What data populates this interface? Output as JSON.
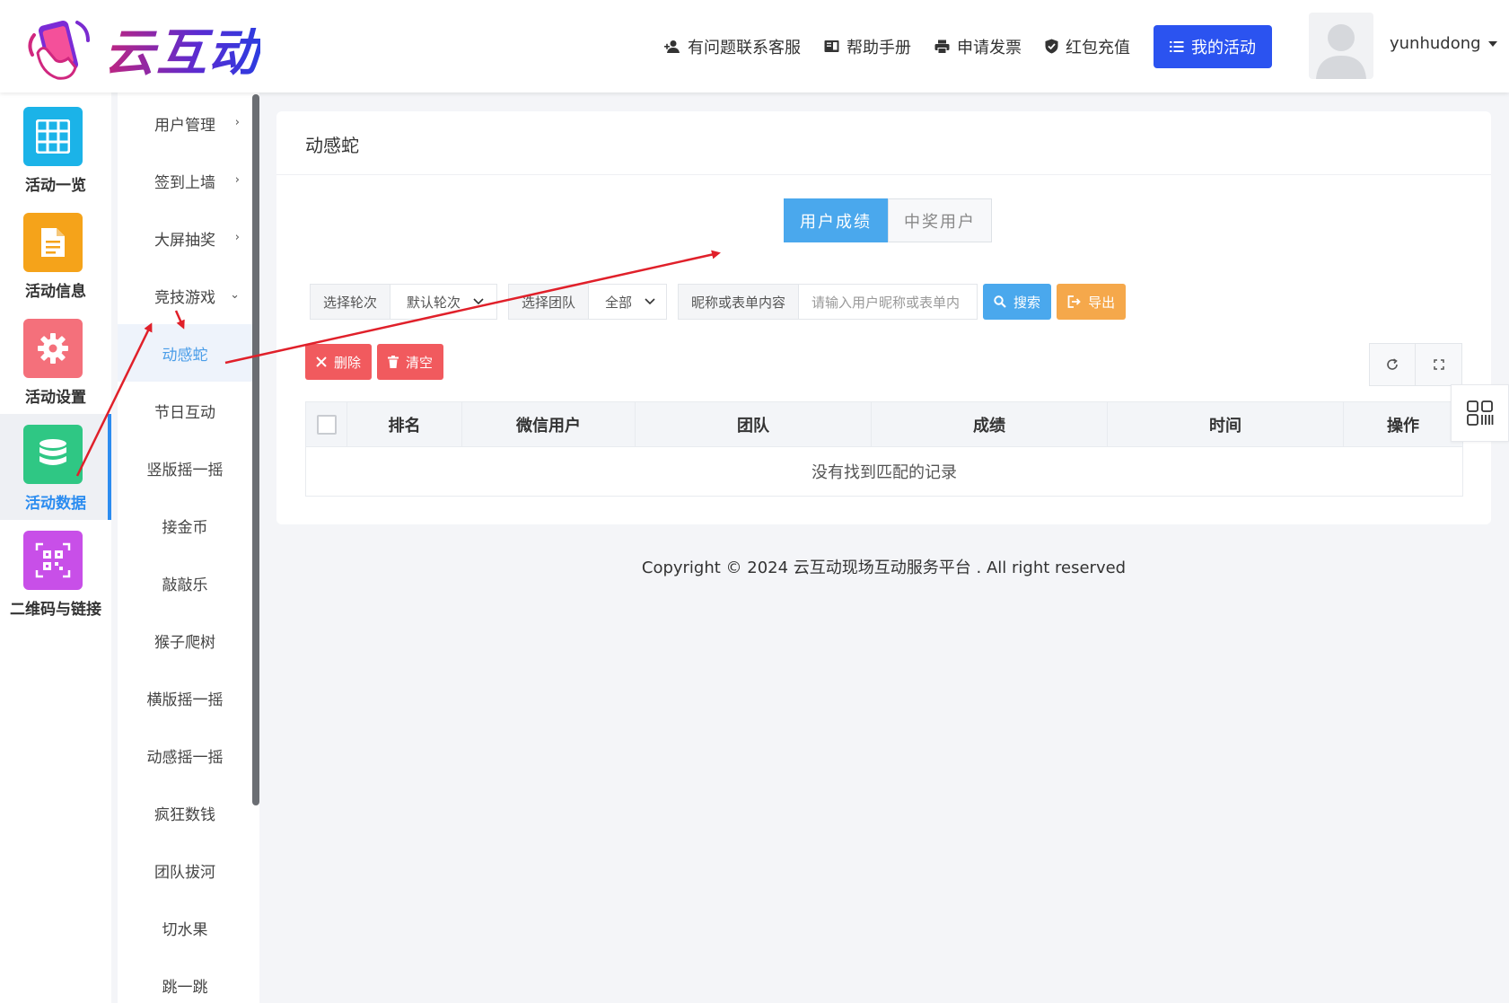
{
  "brand": {
    "name": "云互动"
  },
  "topnav": {
    "support": "有问题联系客服",
    "help": "帮助手册",
    "invoice": "申请发票",
    "recharge": "红包充值",
    "my_activity": "我的活动",
    "username": "yunhudong"
  },
  "iconbar": [
    {
      "label": "活动一览",
      "icon": "grid-icon",
      "color": "#1bb3e8"
    },
    {
      "label": "活动信息",
      "icon": "document-icon",
      "color": "#f5a31a"
    },
    {
      "label": "活动设置",
      "icon": "gear-icon",
      "color": "#f4707b"
    },
    {
      "label": "活动数据",
      "icon": "database-icon",
      "color": "#2fc784",
      "active": true
    },
    {
      "label": "二维码与链接",
      "icon": "qrcode-icon",
      "color": "#c84fe8"
    }
  ],
  "submenu": [
    {
      "label": "用户管理",
      "chevron": "›"
    },
    {
      "label": "签到上墙",
      "chevron": "›"
    },
    {
      "label": "大屏抽奖",
      "chevron": "›"
    },
    {
      "label": "竞技游戏",
      "chevron": "⌄"
    },
    {
      "label": "动感蛇",
      "active": true
    },
    {
      "label": "节日互动"
    },
    {
      "label": "竖版摇一摇"
    },
    {
      "label": "接金币"
    },
    {
      "label": "敲敲乐"
    },
    {
      "label": "猴子爬树"
    },
    {
      "label": "横版摇一摇"
    },
    {
      "label": "动感摇一摇"
    },
    {
      "label": "疯狂数钱"
    },
    {
      "label": "团队拔河"
    },
    {
      "label": "切水果"
    },
    {
      "label": "跳一跳"
    }
  ],
  "main": {
    "title": "动感蛇",
    "tabs": {
      "active": "用户成绩",
      "inactive": "中奖用户"
    },
    "filters": {
      "round_label": "选择轮次",
      "round_value": "默认轮次",
      "team_label": "选择团队",
      "team_value": "全部",
      "keyword_label": "昵称或表单内容",
      "keyword_placeholder": "请输入用户昵称或表单内"
    },
    "buttons": {
      "search": "搜索",
      "export": "导出",
      "delete": "删除",
      "clear": "清空"
    },
    "table": {
      "columns": [
        "排名",
        "微信用户",
        "团队",
        "成绩",
        "时间",
        "操作"
      ],
      "empty_text": "没有找到匹配的记录"
    }
  },
  "footer": {
    "copyright": "Copyright © 2024 云互动现场互动服务平台 . All right reserved"
  },
  "colors": {
    "primary": "#2b53f0",
    "info": "#4aa8ed",
    "warning": "#f5a84b",
    "danger": "#f15a5e",
    "annotation": "#e0202a"
  }
}
